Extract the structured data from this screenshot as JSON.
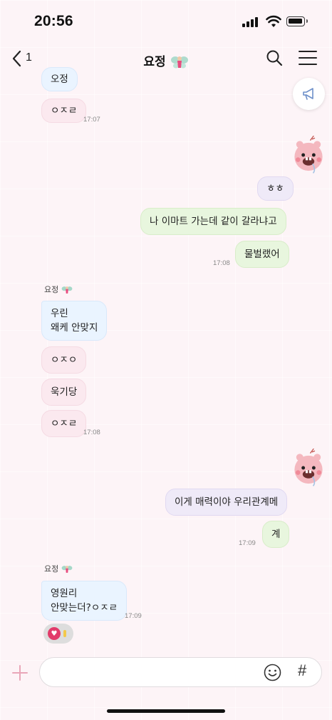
{
  "status_bar": {
    "time": "20:56"
  },
  "header": {
    "back_count": "1",
    "title": "요정",
    "title_icon": "fairy-emoji"
  },
  "messages": {
    "m0_text": "오정",
    "m1_text": "ㅇㅈㄹ",
    "m1_time": "17:07",
    "m2_text": "ㅎㅎ",
    "m3_text": "나 이마트 가는데 같이 갈라냐고",
    "m4_text": "물벌랬어",
    "m4_time": "17:08",
    "g2_sender": "요정",
    "m5_line1": "우린",
    "m5_line2": "왜케 안맞지",
    "m6_text": "ㅇㅈㅇ",
    "m7_text": "욱기당",
    "m8_text": "ㅇㅈㄹ",
    "m8_time": "17:08",
    "m9_text": "이게 매력이야 우리관계메",
    "m10_text": "계",
    "m10_time": "17:09",
    "g3_sender": "요정",
    "m11_line1": "영원리",
    "m11_line2": "안맞는더?ㅇㅈㄹ",
    "m11_time": "17:09"
  },
  "reaction": {
    "icon": "heart-icon"
  },
  "input": {
    "placeholder": "",
    "value": ""
  },
  "colors": {
    "background": "#fdf4f7",
    "bubble_blue": "#eaf4ff",
    "bubble_pink": "#fbe9ef",
    "bubble_green": "#e8f6de",
    "bubble_lavender": "#efeaf8",
    "accent_plus": "#e9a6b8",
    "notice_icon": "#6d8fc9"
  }
}
